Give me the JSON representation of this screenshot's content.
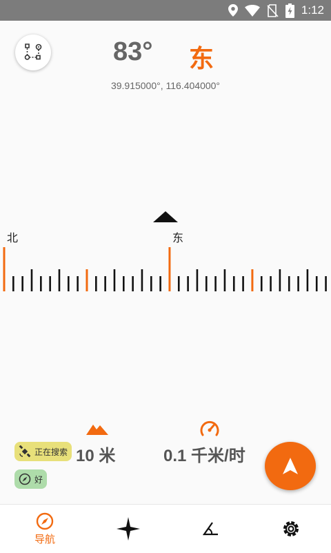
{
  "status_bar": {
    "time": "1:12",
    "icons": [
      "location-icon",
      "wifi-icon",
      "no-sim-icon",
      "battery-charging-icon"
    ]
  },
  "header": {
    "heading_degrees": "83°",
    "heading_direction": "东",
    "coordinates": "39.915000°,  116.404000°"
  },
  "compass_tape": {
    "labels": [
      {
        "text": "北",
        "key": "north"
      },
      {
        "text": "东",
        "key": "east"
      }
    ]
  },
  "stats": {
    "altitude": "10 米",
    "speed": "0.1 千米/时"
  },
  "chips": {
    "gps_status": "正在搜索",
    "compass_accuracy": "好"
  },
  "bottom_nav": {
    "items": [
      {
        "label": "导航",
        "icon": "compass-icon",
        "active": true
      },
      {
        "label": "",
        "icon": "sparkle-icon"
      },
      {
        "label": "",
        "icon": "angle-icon"
      },
      {
        "label": "",
        "icon": "settings-icon"
      }
    ]
  },
  "colors": {
    "accent": "#f26a10",
    "status_bar": "#7c7c7c",
    "gps_chip": "#e8e07a",
    "compass_chip": "#aedcaa"
  }
}
